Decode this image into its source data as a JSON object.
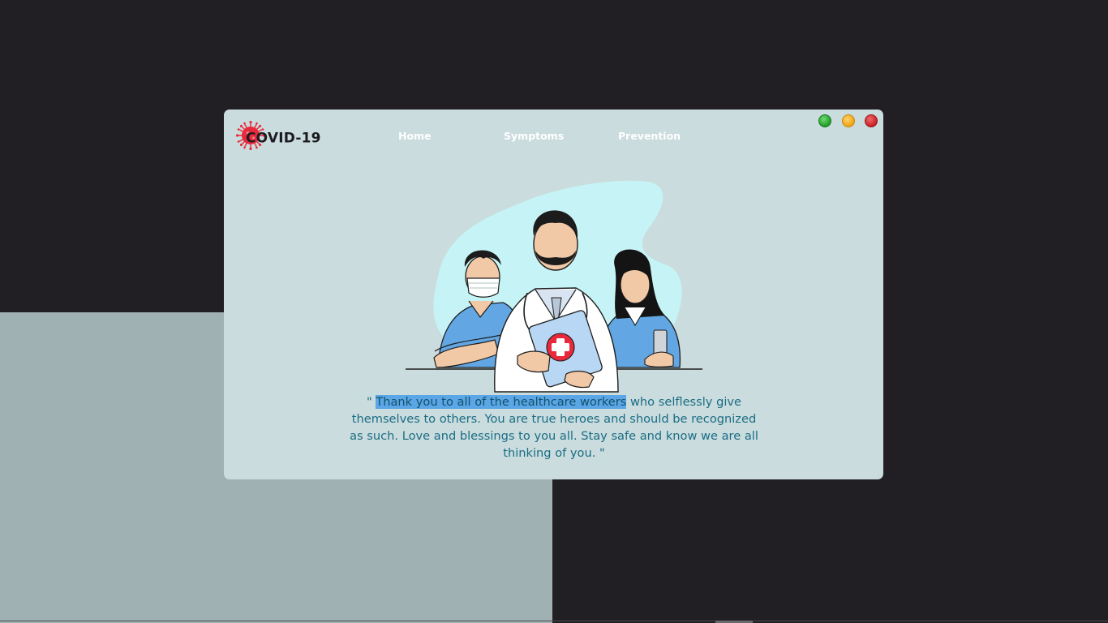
{
  "app": {
    "logo_text": "COVID-19"
  },
  "nav": {
    "home": "Home",
    "symptoms": "Symptoms",
    "prevention": "Prevention"
  },
  "window_controls": [
    "maximize",
    "minimize",
    "close"
  ],
  "quote": {
    "open": "\" ",
    "highlighted": "Thank you to all of the healthcare workers",
    "rest": " who selflessly give themselves to others. You are true heroes and should be recognized as such. Love and blessings to you all. Stay safe and know we are all thinking of you. ",
    "close": "\""
  },
  "illustration": {
    "icon": "healthcare-workers-illustration",
    "badge": "medical-cross-icon"
  },
  "colors": {
    "desktop": "#211f24",
    "panel": "#a0b1b3",
    "window": "#cadcdd",
    "quote_text": "#1a6d85",
    "highlight": "#5aa6e6",
    "accent_red": "#e8293b"
  }
}
